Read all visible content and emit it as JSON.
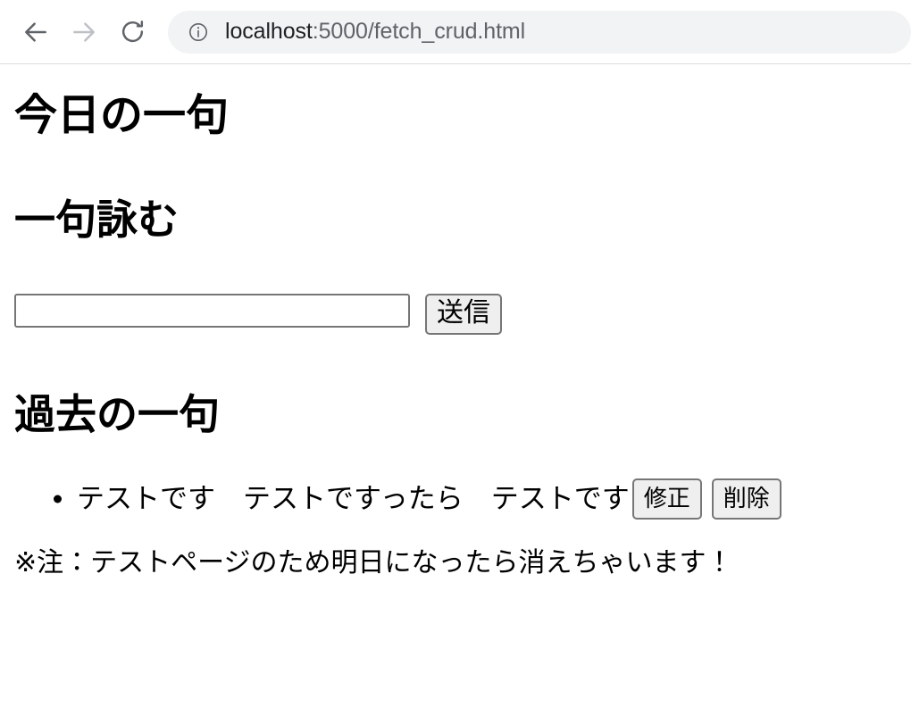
{
  "browser": {
    "back_label": "戻る",
    "forward_label": "進む",
    "reload_label": "再読み込み",
    "url_host": "localhost",
    "url_path": ":5000/fetch_crud.html",
    "site_info_tooltip": "このサイトについての情報を表示"
  },
  "page": {
    "title": "今日の一句",
    "section_title": "一句詠む",
    "form": {
      "input_value": "",
      "input_placeholder": "",
      "submit_label": "送信"
    },
    "list_section_title": "過去の一句",
    "items": [
      {
        "text": "テストです　テストですったら　テストです",
        "edit_label": "修正",
        "delete_label": "削除"
      }
    ],
    "note": "※注：テストページのため明日になったら消えちゃいます！"
  },
  "colors": {
    "omnibox_bg": "#f1f3f4",
    "url_host_text": "#202124",
    "url_path_text": "#5f6368",
    "toolbar_border": "#dadce0",
    "button_bg": "#efefef",
    "button_border": "#767676",
    "input_border": "#767676",
    "text": "#000000",
    "back_icon": "#5f6368",
    "forward_icon": "#bdc1c6",
    "reload_icon": "#5f6368"
  }
}
